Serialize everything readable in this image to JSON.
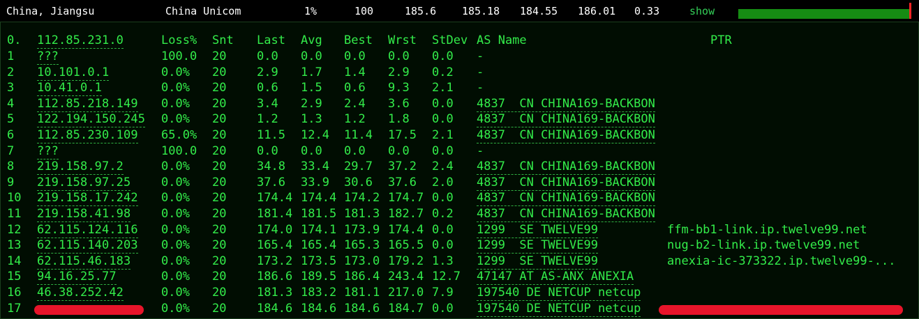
{
  "summary": {
    "location": "China, Jiangsu",
    "isp": "China Unicom",
    "loss": "1%",
    "count": "100",
    "last": "185.6",
    "avg": "185.18",
    "best": "184.55",
    "worst": "186.01",
    "stdev": "0.33",
    "show_label": "show",
    "bar_fill_fraction": 1.0,
    "bar_color": "#168c13",
    "marker_color": "#ff2525"
  },
  "columns": {
    "hop0": "0.",
    "dest": "112.85.231.0",
    "loss": "Loss%",
    "snt": "Snt",
    "last": "Last",
    "avg": "Avg",
    "best": "Best",
    "wrst": "Wrst",
    "stdev": "StDev",
    "as_name": "AS Name",
    "ptr": "PTR"
  },
  "rows": [
    {
      "hop": "1",
      "ip": "???",
      "loss": "100.0",
      "snt": "20",
      "last": "0.0",
      "avg": "0.0",
      "best": "0.0",
      "wrst": "0.0",
      "stdev": "0.0",
      "asn": "-",
      "ptr": ""
    },
    {
      "hop": "2",
      "ip": "10.101.0.1",
      "loss": "0.0%",
      "snt": "20",
      "last": "2.9",
      "avg": "1.7",
      "best": "1.4",
      "wrst": "2.9",
      "stdev": "0.2",
      "asn": "-",
      "ptr": ""
    },
    {
      "hop": "3",
      "ip": "10.41.0.1",
      "loss": "0.0%",
      "snt": "20",
      "last": "0.6",
      "avg": "1.5",
      "best": "0.6",
      "wrst": "9.3",
      "stdev": "2.1",
      "asn": "-",
      "ptr": ""
    },
    {
      "hop": "4",
      "ip": "112.85.218.149",
      "loss": "0.0%",
      "snt": "20",
      "last": "3.4",
      "avg": "2.9",
      "best": "2.4",
      "wrst": "3.6",
      "stdev": "0.0",
      "asn": "4837  CN CHINA169-BACKBON",
      "ptr": ""
    },
    {
      "hop": "5",
      "ip": "122.194.150.245",
      "loss": "0.0%",
      "snt": "20",
      "last": "1.2",
      "avg": "1.3",
      "best": "1.2",
      "wrst": "1.8",
      "stdev": "0.0",
      "asn": "4837  CN CHINA169-BACKBON",
      "ptr": ""
    },
    {
      "hop": "6",
      "ip": "112.85.230.109",
      "loss": "65.0%",
      "snt": "20",
      "last": "11.5",
      "avg": "12.4",
      "best": "11.4",
      "wrst": "17.5",
      "stdev": "2.1",
      "asn": "4837  CN CHINA169-BACKBON",
      "ptr": ""
    },
    {
      "hop": "7",
      "ip": "???",
      "loss": "100.0",
      "snt": "20",
      "last": "0.0",
      "avg": "0.0",
      "best": "0.0",
      "wrst": "0.0",
      "stdev": "0.0",
      "asn": "-",
      "ptr": ""
    },
    {
      "hop": "8",
      "ip": "219.158.97.2",
      "loss": "0.0%",
      "snt": "20",
      "last": "34.8",
      "avg": "33.4",
      "best": "29.7",
      "wrst": "37.2",
      "stdev": "2.4",
      "asn": "4837  CN CHINA169-BACKBON",
      "ptr": ""
    },
    {
      "hop": "9",
      "ip": "219.158.97.25",
      "loss": "0.0%",
      "snt": "20",
      "last": "37.6",
      "avg": "33.9",
      "best": "30.6",
      "wrst": "37.6",
      "stdev": "2.0",
      "asn": "4837  CN CHINA169-BACKBON",
      "ptr": ""
    },
    {
      "hop": "10",
      "ip": "219.158.17.242",
      "loss": "0.0%",
      "snt": "20",
      "last": "174.4",
      "avg": "174.4",
      "best": "174.2",
      "wrst": "174.7",
      "stdev": "0.0",
      "asn": "4837  CN CHINA169-BACKBON",
      "ptr": ""
    },
    {
      "hop": "11",
      "ip": "219.158.41.98",
      "loss": "0.0%",
      "snt": "20",
      "last": "181.4",
      "avg": "181.5",
      "best": "181.3",
      "wrst": "182.7",
      "stdev": "0.2",
      "asn": "4837  CN CHINA169-BACKBON",
      "ptr": ""
    },
    {
      "hop": "12",
      "ip": "62.115.124.116",
      "loss": "0.0%",
      "snt": "20",
      "last": "174.0",
      "avg": "174.1",
      "best": "173.9",
      "wrst": "174.4",
      "stdev": "0.0",
      "asn": "1299  SE TWELVE99",
      "ptr": "ffm-bb1-link.ip.twelve99.net"
    },
    {
      "hop": "13",
      "ip": "62.115.140.203",
      "loss": "0.0%",
      "snt": "20",
      "last": "165.4",
      "avg": "165.4",
      "best": "165.3",
      "wrst": "165.5",
      "stdev": "0.0",
      "asn": "1299  SE TWELVE99",
      "ptr": "nug-b2-link.ip.twelve99.net"
    },
    {
      "hop": "14",
      "ip": "62.115.46.183",
      "loss": "0.0%",
      "snt": "20",
      "last": "173.2",
      "avg": "173.5",
      "best": "173.0",
      "wrst": "179.2",
      "stdev": "1.3",
      "asn": "1299  SE TWELVE99",
      "ptr": "anexia-ic-373322.ip.twelve99-..."
    },
    {
      "hop": "15",
      "ip": "94.16.25.77",
      "loss": "0.0%",
      "snt": "20",
      "last": "186.6",
      "avg": "189.5",
      "best": "186.4",
      "wrst": "243.4",
      "stdev": "12.7",
      "asn": "47147 AT AS-ANX ANEXIA",
      "ptr": ""
    },
    {
      "hop": "16",
      "ip": "46.38.252.42",
      "loss": "0.0%",
      "snt": "20",
      "last": "181.3",
      "avg": "183.2",
      "best": "181.1",
      "wrst": "217.0",
      "stdev": "7.9",
      "asn": "197540 DE NETCUP netcup",
      "ptr": ""
    },
    {
      "hop": "17",
      "ip": "",
      "loss": "0.0%",
      "snt": "20",
      "last": "184.6",
      "avg": "184.6",
      "best": "184.6",
      "wrst": "184.7",
      "stdev": "0.0",
      "asn": "197540 DE NETCUP netcup",
      "ptr": ""
    }
  ],
  "colors": {
    "terminal_text": "#33ec4a",
    "terminal_background": "#010d02",
    "summary_text": "#ffffff",
    "redaction": "#e7152a"
  }
}
